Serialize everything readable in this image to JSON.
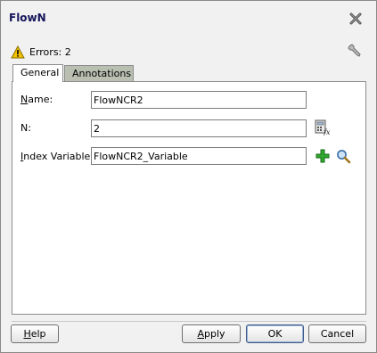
{
  "window": {
    "title": "FlowN"
  },
  "status": {
    "errors_text": "Errors: 2"
  },
  "tabs": [
    {
      "label": "General",
      "selected": true
    },
    {
      "label": "Annotations",
      "selected": false
    }
  ],
  "fields": {
    "name": {
      "label_underlined": "N",
      "label_rest": "ame:",
      "value": "FlowNCR2"
    },
    "n": {
      "label": "N:",
      "value": "2"
    },
    "index_variable": {
      "label_underlined": "I",
      "label_rest": "ndex Variable:",
      "value": "FlowNCR2_Variable"
    }
  },
  "buttons": {
    "help": {
      "underlined": "H",
      "rest": "elp"
    },
    "apply": {
      "underlined": "A",
      "rest": "pply"
    },
    "ok": "OK",
    "cancel": "Cancel"
  },
  "icons": {
    "close": "close-x-icon",
    "warning": "warning-icon",
    "wrench": "wrench-icon",
    "calculator": "expression-builder-icon",
    "add": "plus-icon",
    "search": "search-icon"
  },
  "colors": {
    "title": "#15155b",
    "warning": "#f2c200",
    "plus": "#2fa82f",
    "tab_inactive": "#b9bfb1"
  }
}
